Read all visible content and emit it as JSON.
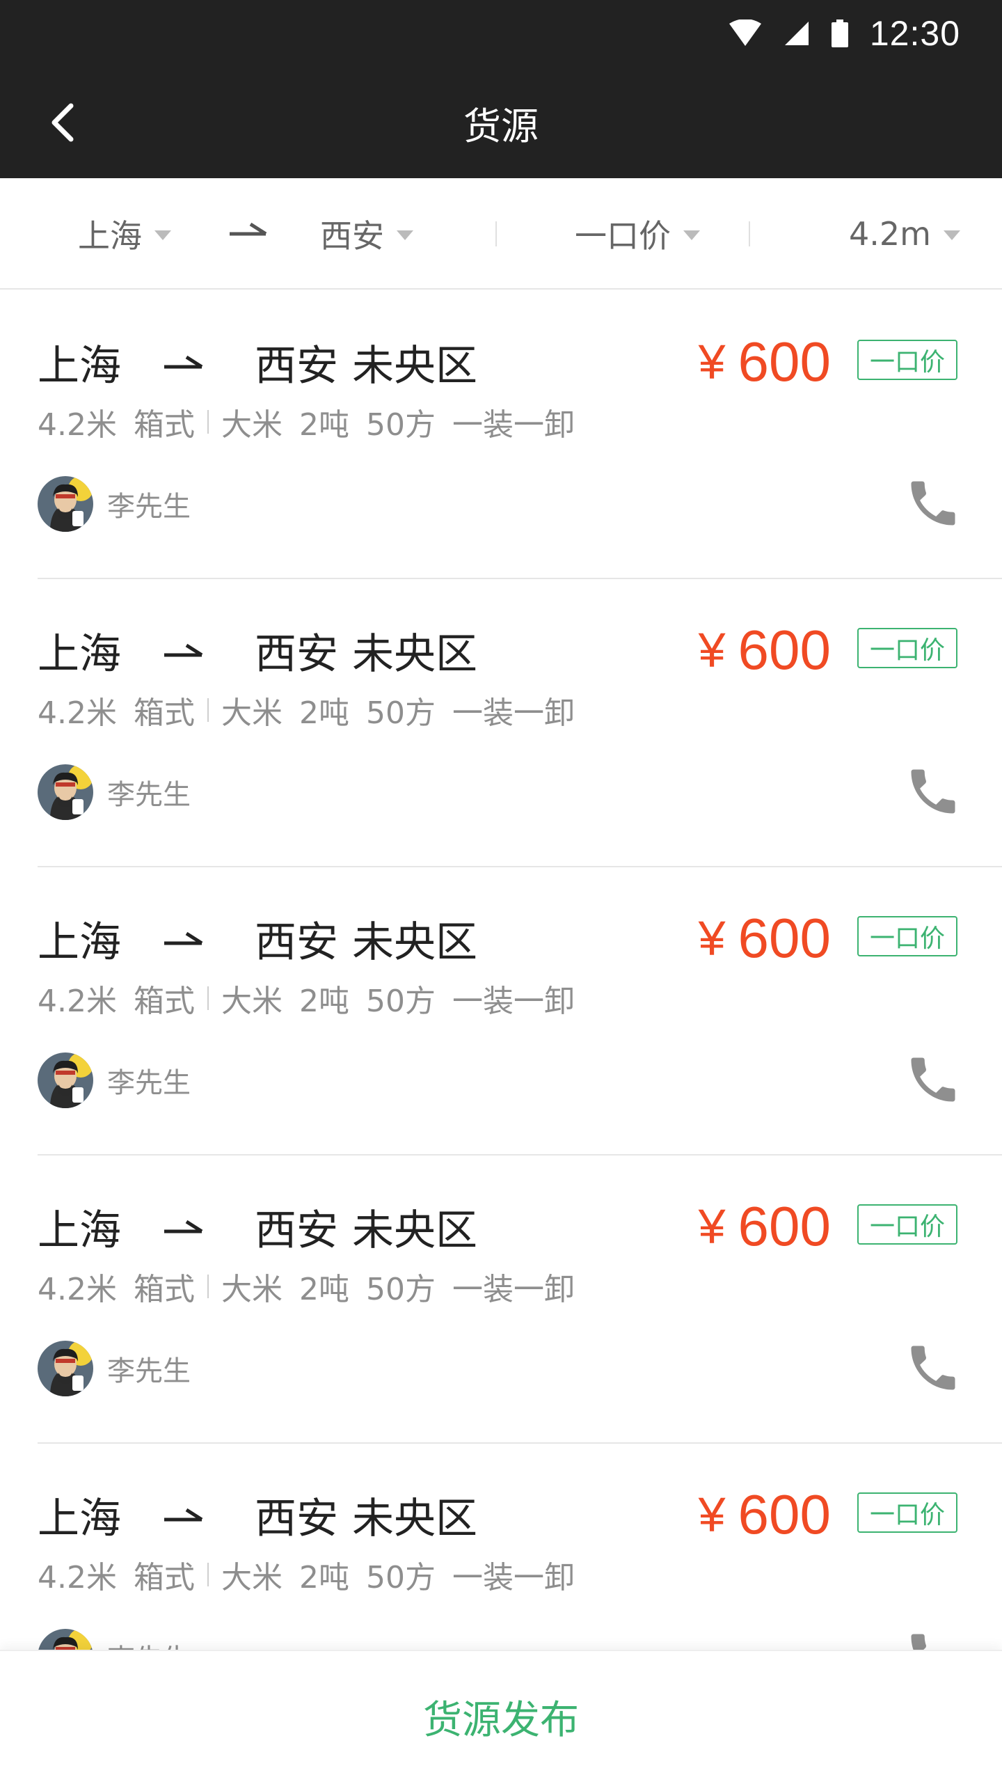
{
  "status_bar": {
    "time": "12:30"
  },
  "nav": {
    "title": "货源"
  },
  "filters": {
    "origin": "上海",
    "destination": "西安",
    "price_type": "一口价",
    "truck_length": "4.2m"
  },
  "cargo_list": [
    {
      "origin": "上海",
      "destination_city": "西安",
      "destination_district": "未央区",
      "price_symbol": "¥",
      "price": "600",
      "price_tag": "一口价",
      "truck_length": "4.2米",
      "truck_type": "箱式",
      "goods": "大米",
      "weight": "2吨",
      "volume": "50方",
      "loading": "一装一卸",
      "contact": "李先生"
    },
    {
      "origin": "上海",
      "destination_city": "西安",
      "destination_district": "未央区",
      "price_symbol": "¥",
      "price": "600",
      "price_tag": "一口价",
      "truck_length": "4.2米",
      "truck_type": "箱式",
      "goods": "大米",
      "weight": "2吨",
      "volume": "50方",
      "loading": "一装一卸",
      "contact": "李先生"
    },
    {
      "origin": "上海",
      "destination_city": "西安",
      "destination_district": "未央区",
      "price_symbol": "¥",
      "price": "600",
      "price_tag": "一口价",
      "truck_length": "4.2米",
      "truck_type": "箱式",
      "goods": "大米",
      "weight": "2吨",
      "volume": "50方",
      "loading": "一装一卸",
      "contact": "李先生"
    },
    {
      "origin": "上海",
      "destination_city": "西安",
      "destination_district": "未央区",
      "price_symbol": "¥",
      "price": "600",
      "price_tag": "一口价",
      "truck_length": "4.2米",
      "truck_type": "箱式",
      "goods": "大米",
      "weight": "2吨",
      "volume": "50方",
      "loading": "一装一卸",
      "contact": "李先生"
    },
    {
      "origin": "上海",
      "destination_city": "西安",
      "destination_district": "未央区",
      "price_symbol": "¥",
      "price": "600",
      "price_tag": "一口价",
      "truck_length": "4.2米",
      "truck_type": "箱式",
      "goods": "大米",
      "weight": "2吨",
      "volume": "50方",
      "loading": "一装一卸",
      "contact": "李先生"
    }
  ],
  "bottom": {
    "publish_label": "货源发布"
  },
  "colors": {
    "header_bg": "#222222",
    "price": "#f04a23",
    "accent_green": "#3cb371"
  },
  "icons": [
    "back-arrow-icon",
    "wifi-icon",
    "signal-icon",
    "battery-icon",
    "route-arrow-icon",
    "phone-icon",
    "caret-down-icon"
  ]
}
